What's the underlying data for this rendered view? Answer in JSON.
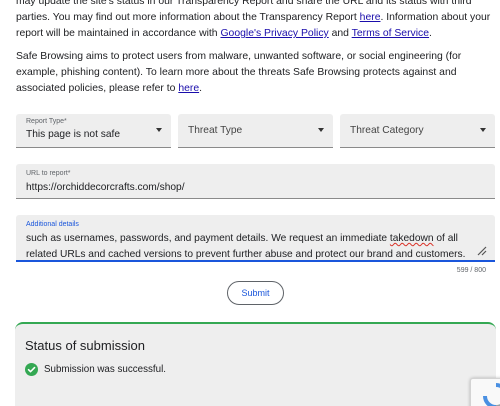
{
  "intro": {
    "line1_pre": "may update the site's status in our Transparency Report and share the URL and its status with third parties. You may find out more information about the Transparency Report ",
    "link_here": "here",
    "line1_mid": ". Information about your report will be maintained in accordance with ",
    "link_privacy": "Google's Privacy Policy",
    "line1_and": " and ",
    "link_terms": "Terms of Service",
    "line1_end": "."
  },
  "safe_browsing": {
    "text_pre": "Safe Browsing aims to protect users from malware, unwanted software, or social engineering (for example, phishing content). To learn more about the threats Safe Browsing protects against and associated policies, please refer to ",
    "link_here": "here",
    "text_end": "."
  },
  "form": {
    "report_type": {
      "label": "Report Type*",
      "value": "This page is not safe"
    },
    "threat_type": {
      "placeholder": "Threat Type"
    },
    "threat_category": {
      "placeholder": "Threat Category"
    },
    "url": {
      "label": "URL to report*",
      "value": "https://orchiddecorcrafts.com/shop/"
    },
    "details": {
      "label": "Additional details",
      "text_pre": "such as usernames, passwords, and payment details. We request an immediate ",
      "text_misspelled": "takedown",
      "text_post": " of all related URLs and cached versions to prevent further abuse and protect our brand and customers."
    },
    "char_counter": "599 / 800",
    "submit_label": "Submit"
  },
  "status": {
    "title": "Status of submission",
    "message": "Submission was successful.",
    "icon": "check-circle-icon",
    "color": "#34a853"
  },
  "colors": {
    "link": "#1a0dab",
    "accent": "#1a56db",
    "field_bg": "#eeeeee"
  }
}
